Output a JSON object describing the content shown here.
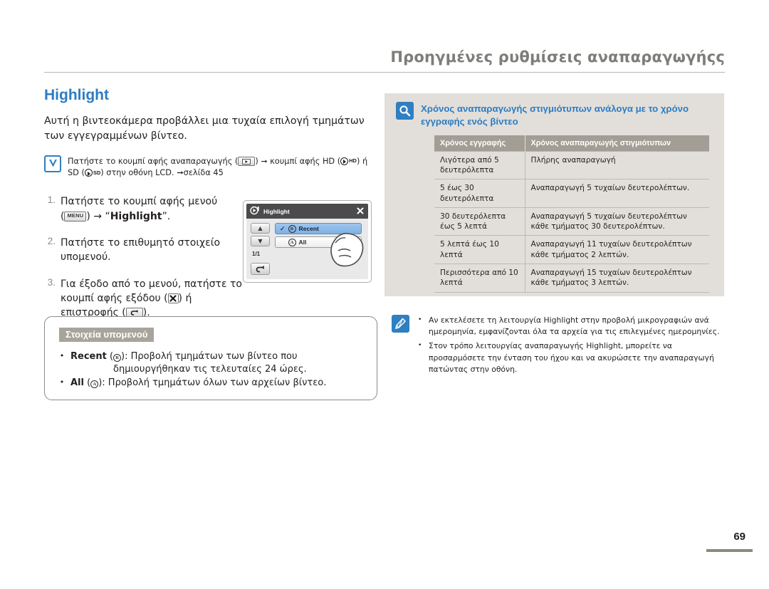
{
  "header": {
    "title": "Προηγμένες ρυθμίσεις αναπαραγωγήςς"
  },
  "left": {
    "section_title": "Highlight",
    "intro": "Αυτή η βιντεοκάμερα προβάλλει μια τυχαία επιλογή τμημάτων των εγγεγραμμένων βίντεο.",
    "info": {
      "icon": "checkmark-v-icon",
      "part1": "Πατήστε το κουμπί αφής αναπαραγωγής (",
      "part2": ") ",
      "arrow": "➞",
      "part3": " κουμπί αφής HD (",
      "hd_label": "HD",
      "part4": ") ή",
      "part5": "SD (",
      "sd_label": "SD",
      "part6": ") στην οθόνη LCD. ",
      "page_ref_arrow": "➞",
      "page_ref": "σελίδα 45"
    },
    "steps": [
      {
        "num": "1.",
        "pre": "Πατήστε το κουμπί αφής μενού",
        "paren_open": "(",
        "key": "MENU",
        "paren_close": ") ",
        "arrow": "→",
        "post": " “",
        "bold": "Highlight",
        "tail": "”."
      },
      {
        "num": "2.",
        "text": "Πατήστε το επιθυμητό στοιχείο υπομενού."
      },
      {
        "num": "3.",
        "pre": "Για έξοδο από το μενού, πατήστε το κουμπί αφής εξόδου (",
        "mid": ") ή",
        "post2": "επιστροφής (",
        "tail": ")."
      }
    ],
    "lcd": {
      "title": "Highlight",
      "close_icon": "close-x-icon",
      "menu_icon": "playback-mode-icon",
      "up_icon": "▲",
      "down_icon": "▼",
      "page_indicator": "1/1",
      "return_icon": "↰",
      "options": [
        {
          "label": "Recent",
          "badge": "R",
          "checked": true
        },
        {
          "label": "All",
          "badge": "A",
          "checked": false
        }
      ]
    },
    "submenu": {
      "tag": "Στοιχεία υπομενού",
      "items": [
        {
          "bullet": "•",
          "name": "Recent",
          "badge": "R",
          "desc": "): Προβολή τμημάτων των βίντεο που",
          "desc2": "δημιουργήθηκαν τις τελευταίες 24 ώρες."
        },
        {
          "bullet": "•",
          "name": "All",
          "badge": "A",
          "desc": "): Προβολή τμημάτων όλων των αρχείων βίντεο.",
          "desc2": ""
        }
      ],
      "paren_open": " ("
    }
  },
  "right": {
    "icon": "magnifier-icon",
    "title": "Χρόνος αναπαραγωγής στιγμιότυπων ανάλογα με το χρόνο εγγραφής ενός βίντεο",
    "table": {
      "headers": [
        "Χρόνος εγγραφής",
        "Χρόνος αναπαραγωγής στιγμιότυπων"
      ],
      "rows": [
        [
          "Λιγότερα από 5 δευτερόλεπτα",
          "Πλήρης αναπαραγωγή"
        ],
        [
          "5 έως 30 δευτερόλεπτα",
          "Αναπαραγωγή 5 τυχαίων δευτερολέπτων."
        ],
        [
          "30 δευτερόλεπτα έως 5 λεπτά",
          "Αναπαραγωγή 5 τυχαίων δευτερολέπτων κάθε τμήματος 30 δευτερολέπτων."
        ],
        [
          "5 λεπτά έως 10 λεπτά",
          "Αναπαραγωγή 11 τυχαίων δευτερολέπτων κάθε τμήματος 2 λεπτών."
        ],
        [
          "Περισσότερα από 10 λεπτά",
          "Αναπαραγωγή 15 τυχαίων δευτερολέπτων κάθε τμήματος 3 λεπτών."
        ]
      ]
    },
    "note": {
      "icon": "pen-note-icon",
      "items": [
        "Αν εκτελέσετε τη λειτουργία Highlight στην προβολή μικρογραφιών ανά ημερομηνία, εμφανίζονται όλα τα αρχεία για τις επιλεγμένες ημερομηνίες.",
        "Στον τρόπο λειτουργίας αναπαραγωγής Highlight, μπορείτε να προσαρμόσετε την ένταση του ήχου και να ακυρώσετε την αναπαραγωγή πατώντας στην οθόνη."
      ],
      "bullet": "•"
    }
  },
  "footer": {
    "page_number": "69"
  },
  "colors": {
    "accent_blue": "#2b7cc4",
    "header_gray": "#7e7d7a",
    "panel_bg": "#e2dfda",
    "table_header": "#a39e95",
    "tag_bg": "#a8a49c"
  }
}
